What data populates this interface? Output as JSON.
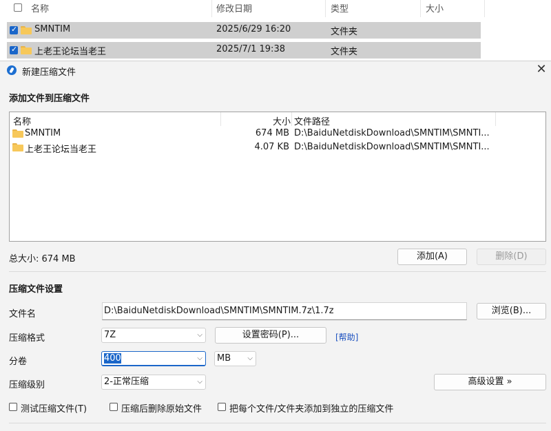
{
  "explorer": {
    "columns": {
      "name": "名称",
      "modified": "修改日期",
      "type": "类型",
      "size": "大小"
    },
    "rows": [
      {
        "name": "SMNTIM",
        "modified": "2025/6/29 16:20",
        "type": "文件夹"
      },
      {
        "name": "上老王论坛当老王",
        "modified": "2025/7/1 19:38",
        "type": "文件夹"
      }
    ]
  },
  "dialog": {
    "title": "新建压缩文件",
    "add_section_title": "添加文件到压缩文件",
    "filelist": {
      "columns": {
        "name": "名称",
        "size": "大小",
        "path": "文件路径"
      },
      "rows": [
        {
          "name": "SMNTIM",
          "size": "674 MB",
          "path": "D:\\BaiduNetdiskDownload\\SMNTIM\\SMNTI..."
        },
        {
          "name": "上老王论坛当老王",
          "size": "4.07 KB",
          "path": "D:\\BaiduNetdiskDownload\\SMNTIM\\SMNTI..."
        }
      ]
    },
    "total_size": "总大小: 674 MB",
    "add_button": "添加(A)",
    "delete_button": "删除(D)",
    "settings_title": "压缩文件设置",
    "filename_label": "文件名",
    "filename_value": "D:\\BaiduNetdiskDownload\\SMNTIM\\SMNTIM.7z\\1.7z",
    "browse_button": "浏览(B)...",
    "format_label": "压缩格式",
    "format_value": "7Z",
    "password_button": "设置密码(P)...",
    "help_link": "[帮助]",
    "volume_label": "分卷",
    "volume_value": "400",
    "volume_unit": "MB",
    "level_label": "压缩级别",
    "level_value": "2-正常压缩",
    "advanced_button": "高级设置 »",
    "test_checkbox": "测试压缩文件(T)",
    "delete_source_checkbox": "压缩后删除原始文件",
    "separate_checkbox": "把每个文件/文件夹添加到独立的压缩文件"
  },
  "colors": {
    "accent": "#1a66c9",
    "link": "#1a4fbf",
    "selection": "#cfcfcf"
  }
}
